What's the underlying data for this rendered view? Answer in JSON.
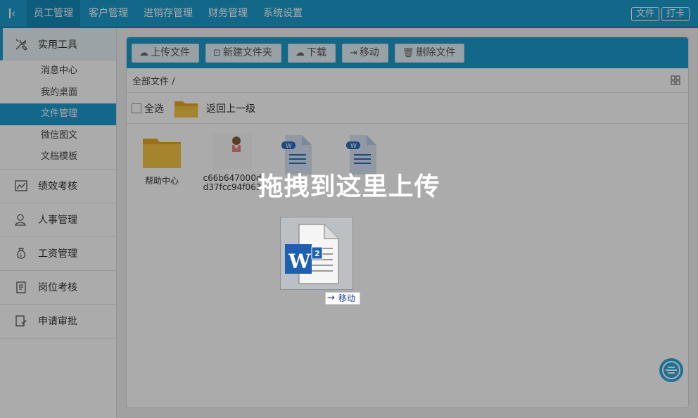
{
  "topbar": {
    "nav": [
      "员工管理",
      "客户管理",
      "进销存管理",
      "财务管理",
      "系统设置"
    ],
    "right_buttons": [
      "文件",
      "打卡"
    ]
  },
  "sidebar": {
    "groups": [
      {
        "label": "实用工具",
        "icon": "tools-icon",
        "open": true,
        "items": [
          "消息中心",
          "我的桌面",
          "文件管理",
          "微信图文",
          "文档模板"
        ]
      },
      {
        "label": "绩效考核",
        "icon": "chart-icon"
      },
      {
        "label": "人事管理",
        "icon": "user-icon"
      },
      {
        "label": "工资管理",
        "icon": "money-bag-icon"
      },
      {
        "label": "岗位考核",
        "icon": "clipboard-icon"
      },
      {
        "label": "申请审批",
        "icon": "approve-icon"
      }
    ],
    "active_item": "文件管理"
  },
  "toolbar": {
    "upload": "上传文件",
    "new_folder": "新建文件夹",
    "download": "下载",
    "move": "移动",
    "delete": "删除文件"
  },
  "breadcrumb": "全部文件 /",
  "select_row": {
    "select_all": "全选",
    "go_up": "返回上一级"
  },
  "files": [
    {
      "name": "帮助中心",
      "type": "folder"
    },
    {
      "name": "c66b647000dd37fcc94f063304a49120",
      "type": "image"
    },
    {
      "name": "",
      "type": "word"
    },
    {
      "name": "",
      "type": "word"
    }
  ],
  "drag": {
    "drop_text": "拖拽到这里上传",
    "tip": "移动",
    "badge": "2"
  },
  "colors": {
    "accent": "#1d9ccd",
    "folder": "#f5c542"
  }
}
